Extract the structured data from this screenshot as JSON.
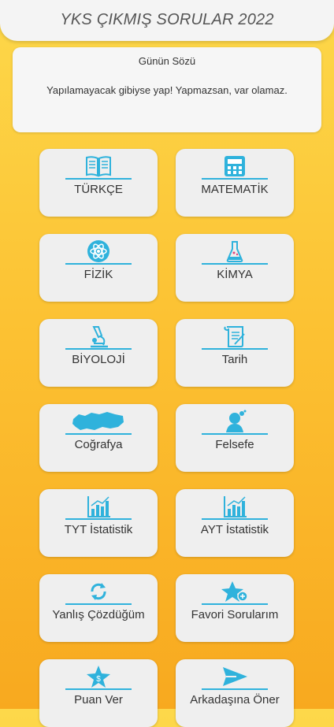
{
  "app_title": "YKS ÇIKMIŞ SORULAR 2022",
  "quote": {
    "title": "Günün Sözü",
    "text": "Yapılamayacak gibiyse yap! Yapmazsan, var olamaz."
  },
  "accent_color": "#2fb2dc",
  "buttons": [
    {
      "label": "TÜRKÇE",
      "icon": "book-icon"
    },
    {
      "label": "MATEMATİK",
      "icon": "calculator-icon"
    },
    {
      "label": "FİZİK",
      "icon": "atom-icon"
    },
    {
      "label": "KİMYA",
      "icon": "flask-icon"
    },
    {
      "label": "BİYOLOJİ",
      "icon": "microscope-icon"
    },
    {
      "label": "Tarih",
      "icon": "scroll-icon"
    },
    {
      "label": "Coğrafya",
      "icon": "turkey-map-icon"
    },
    {
      "label": "Felsefe",
      "icon": "thinker-icon"
    },
    {
      "label": "TYT İstatistik",
      "icon": "statistics-chart-icon"
    },
    {
      "label": "AYT İstatistik",
      "icon": "statistics-chart-icon"
    },
    {
      "label": "Yanlış Çözdüğüm",
      "icon": "refresh-icon"
    },
    {
      "label": "Favori Sorularım",
      "icon": "star-plus-icon"
    },
    {
      "label": "Puan Ver",
      "icon": "star-dollar-icon"
    },
    {
      "label": "Arkadaşına Öner",
      "icon": "send-icon"
    }
  ]
}
